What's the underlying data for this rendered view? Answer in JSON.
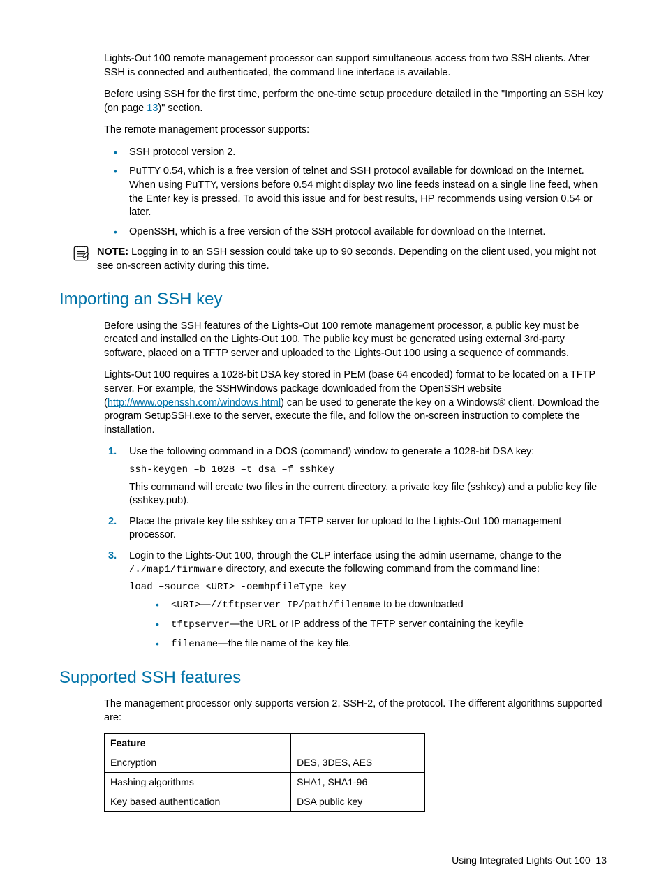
{
  "intro": {
    "p1": "Lights-Out 100 remote management processor can support simultaneous access from two SSH clients. After SSH is connected and authenticated, the command line interface is available.",
    "p2a": "Before using SSH for the first time, perform the one-time setup procedure detailed in the \"Importing an SSH key (on page ",
    "p2_link": "13",
    "p2b": ")\" section.",
    "p3": "The remote management processor supports:",
    "b1": "SSH protocol version 2.",
    "b2": "PuTTY 0.54, which is a free version of telnet and SSH protocol available for download on the Internet. When using PuTTY, versions before 0.54 might display two line feeds instead on a single line feed, when the Enter key is pressed. To avoid this issue and for best results, HP recommends using version 0.54 or later.",
    "b3": "OpenSSH, which is a free version of the SSH protocol available for download on the Internet."
  },
  "note": {
    "label": "NOTE:",
    "text": " Logging in to an SSH session could take up to 90 seconds. Depending on the client used, you might not see on-screen activity during this time."
  },
  "importing": {
    "heading": "Importing an SSH key",
    "p1": "Before using the SSH features of the Lights-Out 100 remote management processor, a public key must be created and installed on the Lights-Out 100. The public key must be generated using external 3rd-party software, placed on a TFTP server and uploaded to the Lights-Out 100 using a sequence of commands.",
    "p2a": "Lights-Out 100 requires a 1028-bit DSA key stored in PEM (base 64 encoded) format to be located on a TFTP server. For example, the SSHWindows package downloaded from the OpenSSH website (",
    "p2_link": "http://www.openssh.com/windows.html",
    "p2b": ") can be used to generate the key on a Windows® client. Download the program SetupSSH.exe to the server, execute the file, and follow the on-screen instruction to complete the installation.",
    "step1_a": "Use the following command in a DOS (command) window to generate a 1028-bit DSA key:",
    "step1_code": "ssh-keygen –b 1028 –t dsa –f sshkey",
    "step1_b": "This command will create two files in the current directory, a private key file (sshkey) and a public key file (sshkey.pub).",
    "step2": "Place the private key file sshkey on a TFTP server for upload to the Lights-Out 100 management processor.",
    "step3_a": "Login to the Lights-Out 100, through the CLP interface using the admin username, change to the ",
    "step3_path": "/./map1/firmware",
    "step3_b": " directory, and execute the following command from the command line:",
    "step3_code": "load –source <URI> -oemhpfileType key",
    "step3_sub1_code": "<URI>",
    "step3_sub1_dash": "—",
    "step3_sub1_code2": "//tftpserver IP/path/filename",
    "step3_sub1_text": " to be downloaded",
    "step3_sub2_code": "tftpserver",
    "step3_sub2_text": "—the URL or IP address of the TFTP server containing the keyfile",
    "step3_sub3_code": "filename",
    "step3_sub3_text": "—the file name of the key file."
  },
  "supported": {
    "heading": "Supported SSH features",
    "p1": "The management processor only supports version 2, SSH-2, of the protocol. The different algorithms supported are:",
    "table": {
      "header1": "Feature",
      "header2": "",
      "rows": [
        [
          "Encryption",
          "DES, 3DES, AES"
        ],
        [
          "Hashing algorithms",
          "SHA1, SHA1-96"
        ],
        [
          "Key based authentication",
          "DSA public key"
        ]
      ]
    }
  },
  "footer": {
    "text": "Using Integrated Lights-Out 100",
    "page": "13"
  }
}
